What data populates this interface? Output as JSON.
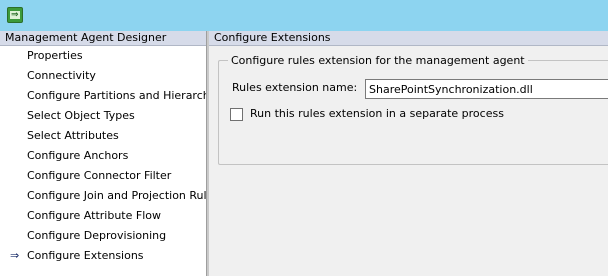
{
  "titlebar": {
    "icon": "app-icon",
    "color": "#8dd4f0"
  },
  "left_panel": {
    "header": "Management Agent Designer",
    "items": [
      {
        "label": "Properties",
        "active": false
      },
      {
        "label": "Connectivity",
        "active": false
      },
      {
        "label": "Configure Partitions and Hierarchies",
        "active": false
      },
      {
        "label": "Select Object Types",
        "active": false
      },
      {
        "label": "Select Attributes",
        "active": false
      },
      {
        "label": "Configure Anchors",
        "active": false
      },
      {
        "label": "Configure Connector Filter",
        "active": false
      },
      {
        "label": "Configure Join and Projection Rules",
        "active": false
      },
      {
        "label": "Configure Attribute Flow",
        "active": false
      },
      {
        "label": "Configure Deprovisioning",
        "active": false
      },
      {
        "label": "Configure Extensions",
        "active": true
      }
    ],
    "active_marker": "⇒"
  },
  "right_panel": {
    "header": "Configure Extensions",
    "group": {
      "title": "Configure rules extension for the management agent",
      "rules_extension_label": "Rules extension name:",
      "rules_extension_value": "SharePointSynchronization.dll",
      "separate_process_label": "Run this rules extension in a separate process",
      "separate_process_checked": false
    }
  }
}
